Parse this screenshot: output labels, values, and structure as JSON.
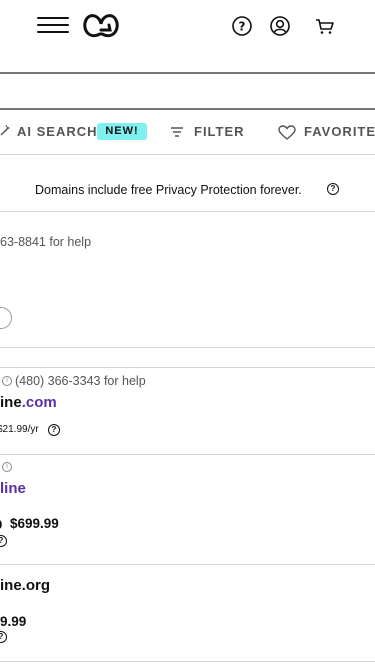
{
  "header": {
    "menu_icon": "hamburger-icon",
    "logo_icon": "godaddy-logo-icon",
    "help_icon": "help-circle-icon",
    "account_icon": "account-icon",
    "cart_icon": "cart-icon"
  },
  "filter_bar": {
    "ai_search_label": "AI SEARCH",
    "new_badge": "NEW!",
    "filter_label": "FILTER",
    "favorites_label": "FAVORITE"
  },
  "privacy_notice": "Domains include free Privacy Protection forever.",
  "help_line_1": "63-8841 for help",
  "results": [
    {
      "help": "(480) 366-3343 for help",
      "domain_prefix": "ine",
      "domain_tld": ".com",
      "price": "$21.99/yr"
    },
    {
      "domain": "line",
      "old_price": "9",
      "price": "$699.99"
    },
    {
      "domain": "ine.org",
      "price": "9.99"
    }
  ],
  "colors": {
    "accent_purple": "#5b2ea6",
    "badge_cyan": "#7ff0f0"
  }
}
